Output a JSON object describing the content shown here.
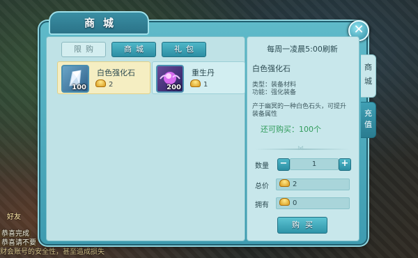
{
  "window": {
    "title": "商城",
    "close_icon": "close-x-icon"
  },
  "tabs": [
    {
      "label": "限购",
      "active": true
    },
    {
      "label": "商城",
      "active": false
    },
    {
      "label": "礼包",
      "active": false
    }
  ],
  "items": [
    {
      "name": "白色强化石",
      "quantity": "100",
      "price": "2",
      "selected": true,
      "icon": "white-crystal-icon"
    },
    {
      "name": "重生丹",
      "quantity": "200",
      "price": "1",
      "selected": false,
      "icon": "purple-gem-icon"
    }
  ],
  "detail": {
    "refresh": "每周一凌晨5:00刷新",
    "name": "白色强化石",
    "type": "类型：装备材料",
    "function": "功能：强化装备",
    "desc": "产于幽冥的一种白色石头，可提升装备属性",
    "remaining": "还可购买：100个"
  },
  "purchase": {
    "qty_label": "数量",
    "qty_value": "1",
    "total_label": "总价",
    "total_value": "2",
    "owned_label": "拥有",
    "owned_value": "0",
    "buy_label": "购买"
  },
  "side_tabs": [
    {
      "label": "商城",
      "active": true
    },
    {
      "label": "充值",
      "active": false
    }
  ],
  "background": {
    "friend": "好友",
    "chat_line1": "恭喜完成",
    "chat_line2": "恭喜请不要",
    "chat_line3": "财会账号的安全性，甚至造成损失"
  },
  "colors": {
    "accent": "#3e9bb0",
    "selected": "#f5eec2",
    "remain_text": "#2f9b5a"
  }
}
